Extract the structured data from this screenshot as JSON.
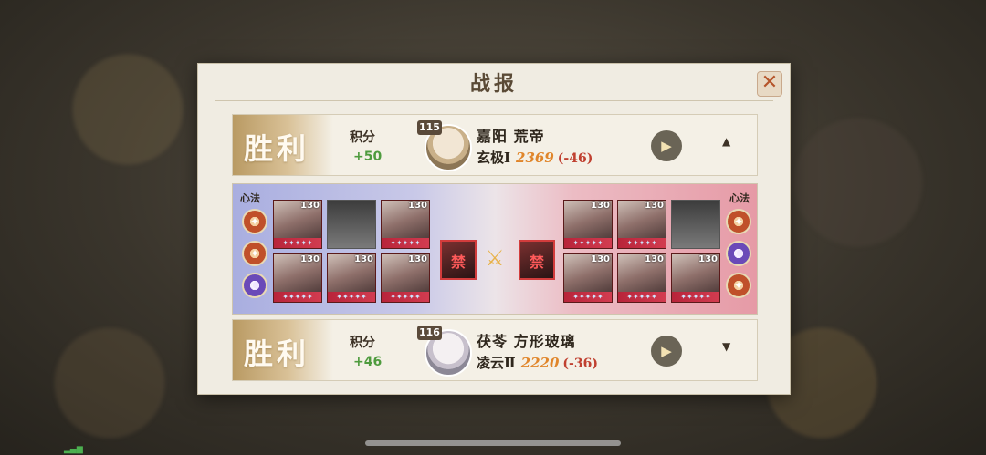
{
  "background": {
    "title": ""
  },
  "dialog": {
    "title": "战报",
    "close_icon": "close-x-icon"
  },
  "matches": [
    {
      "result": "胜利",
      "score_label": "积分",
      "score_change": "+50",
      "level": "115",
      "player_name": "嘉阳 荒帝",
      "rank": "玄极Ⅰ",
      "rating": "2369",
      "rating_change": "(-46)",
      "toggle_icon": "chevron-up-icon"
    },
    {
      "result": "胜利",
      "score_label": "积分",
      "score_change": "+46",
      "level": "116",
      "player_name": "茯苓 方形玻璃",
      "rank": "凌云Ⅱ",
      "rating": "2220",
      "rating_change": "(-36)",
      "toggle_icon": "chevron-down-icon"
    }
  ],
  "lineup": {
    "xinfa_label": "心法",
    "ban_label": "禁",
    "left_cards": [
      {
        "level": "130",
        "empty": false
      },
      {
        "level": "",
        "empty": true
      },
      {
        "level": "130",
        "empty": false
      },
      {
        "level": "130",
        "empty": false
      },
      {
        "level": "130",
        "empty": false
      },
      {
        "level": "130",
        "empty": false
      }
    ],
    "right_cards": [
      {
        "level": "130",
        "empty": false
      },
      {
        "level": "130",
        "empty": false
      },
      {
        "level": "",
        "empty": true
      },
      {
        "level": "130",
        "empty": false
      },
      {
        "level": "130",
        "empty": false
      },
      {
        "level": "130",
        "empty": false
      }
    ],
    "stars": "✦✦✦✦✦"
  },
  "colors": {
    "victory_gold": "#b99a63",
    "score_green": "#4e9b3e",
    "rating_orange": "#e0852a",
    "delta_red": "#c04030"
  }
}
